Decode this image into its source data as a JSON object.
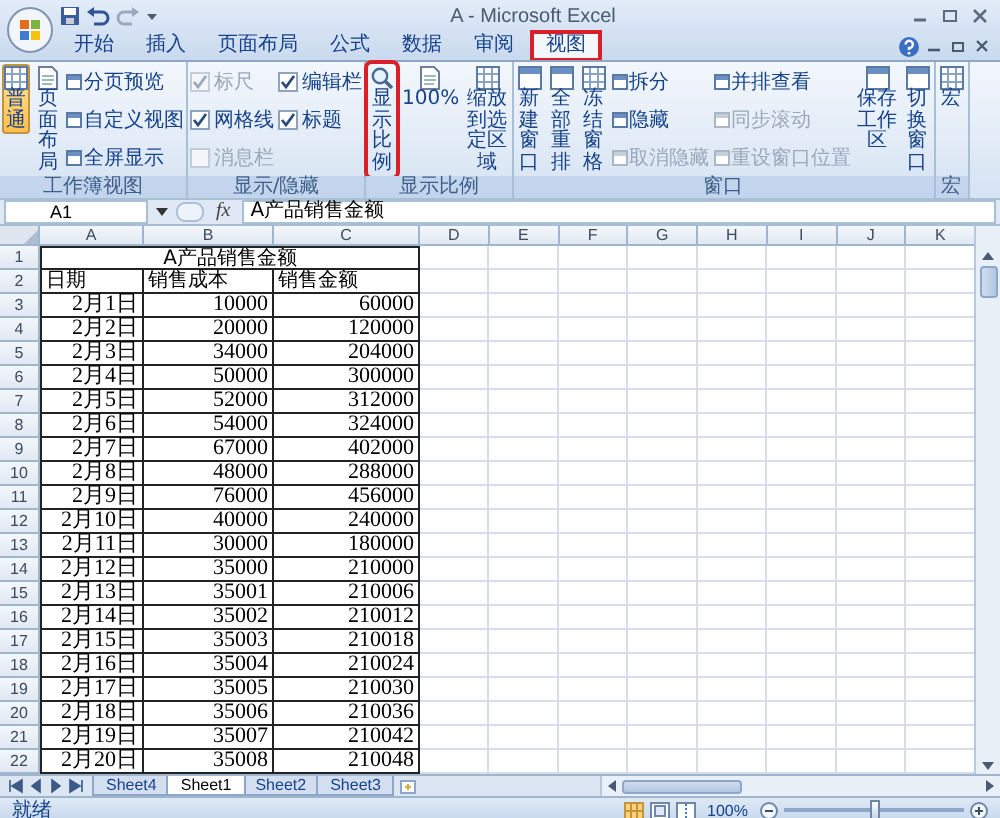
{
  "window": {
    "title": "A - Microsoft Excel"
  },
  "tabs": [
    {
      "label": "开始",
      "selected": false,
      "highlighted": false
    },
    {
      "label": "插入",
      "selected": false,
      "highlighted": false
    },
    {
      "label": "页面布局",
      "selected": false,
      "highlighted": false
    },
    {
      "label": "公式",
      "selected": false,
      "highlighted": false
    },
    {
      "label": "数据",
      "selected": false,
      "highlighted": false
    },
    {
      "label": "审阅",
      "selected": false,
      "highlighted": false
    },
    {
      "label": "视图",
      "selected": true,
      "highlighted": true
    }
  ],
  "ribbon": {
    "groups": [
      {
        "label": "工作簿视图",
        "items": [
          {
            "kind": "tall",
            "label": "普通",
            "selected": true,
            "highlighted": false
          },
          {
            "kind": "tall",
            "label": "页面布局",
            "selected": false,
            "highlighted": false
          },
          {
            "kind": "column",
            "items": [
              {
                "kind": "small",
                "label": "分页预览",
                "disabled": false
              },
              {
                "kind": "small",
                "label": "自定义视图",
                "disabled": false
              },
              {
                "kind": "small",
                "label": "全屏显示",
                "disabled": false
              }
            ]
          }
        ]
      },
      {
        "label": "显示/隐藏",
        "items": [
          {
            "kind": "column",
            "items": [
              {
                "kind": "check",
                "label": "标尺",
                "checked": true,
                "disabled": true
              },
              {
                "kind": "check",
                "label": "网格线",
                "checked": true,
                "disabled": false
              },
              {
                "kind": "check",
                "label": "消息栏",
                "checked": false,
                "disabled": true
              }
            ]
          },
          {
            "kind": "column",
            "items": [
              {
                "kind": "check",
                "label": "编辑栏",
                "checked": true,
                "disabled": false
              },
              {
                "kind": "check",
                "label": "标题",
                "checked": true,
                "disabled": false
              }
            ]
          }
        ]
      },
      {
        "label": "显示比例",
        "items": [
          {
            "kind": "tall",
            "label": "显示比例",
            "selected": false,
            "highlighted": true
          },
          {
            "kind": "plain",
            "label": "100%",
            "selected": false,
            "highlighted": false
          },
          {
            "kind": "wide",
            "label": "缩放到选定区域",
            "selected": false,
            "highlighted": false
          }
        ]
      },
      {
        "label": "窗口",
        "items": [
          {
            "kind": "tall",
            "label": "新建窗口",
            "selected": false,
            "highlighted": false
          },
          {
            "kind": "tall",
            "label": "全部重排",
            "selected": false,
            "highlighted": false
          },
          {
            "kind": "tall",
            "label": "冻结窗格",
            "selected": false,
            "highlighted": false
          },
          {
            "kind": "column",
            "items": [
              {
                "kind": "small",
                "label": "拆分",
                "disabled": false
              },
              {
                "kind": "small",
                "label": "隐藏",
                "disabled": false
              },
              {
                "kind": "small",
                "label": "取消隐藏",
                "disabled": true
              }
            ]
          },
          {
            "kind": "column",
            "items": [
              {
                "kind": "small",
                "label": "并排查看",
                "disabled": false
              },
              {
                "kind": "small",
                "label": "同步滚动",
                "disabled": true
              },
              {
                "kind": "small",
                "label": "重设窗口位置",
                "disabled": true
              }
            ]
          },
          {
            "kind": "wide",
            "label": "保存工作区",
            "selected": false,
            "highlighted": false
          },
          {
            "kind": "tall",
            "label": "切换窗口",
            "selected": false,
            "highlighted": false
          }
        ]
      },
      {
        "label": "宏",
        "items": [
          {
            "kind": "tall",
            "label": "宏",
            "selected": false,
            "highlighted": false
          }
        ]
      }
    ]
  },
  "formula_bar": {
    "name_box": "A1",
    "function_label": "fx",
    "content": "A产品销售金额"
  },
  "columns": [
    "A",
    "B",
    "C",
    "D",
    "E",
    "F",
    "G",
    "H",
    "I",
    "J",
    "K"
  ],
  "sheet": {
    "title_row": {
      "number": "1",
      "text": "A产品销售金额"
    },
    "header_row": {
      "number": "2",
      "cells": [
        "日期",
        "销售成本",
        "销售金额"
      ]
    },
    "data_rows": [
      {
        "number": "3",
        "cells": [
          "2月1日",
          "10000",
          "60000"
        ]
      },
      {
        "number": "4",
        "cells": [
          "2月2日",
          "20000",
          "120000"
        ]
      },
      {
        "number": "5",
        "cells": [
          "2月3日",
          "34000",
          "204000"
        ]
      },
      {
        "number": "6",
        "cells": [
          "2月4日",
          "50000",
          "300000"
        ]
      },
      {
        "number": "7",
        "cells": [
          "2月5日",
          "52000",
          "312000"
        ]
      },
      {
        "number": "8",
        "cells": [
          "2月6日",
          "54000",
          "324000"
        ]
      },
      {
        "number": "9",
        "cells": [
          "2月7日",
          "67000",
          "402000"
        ]
      },
      {
        "number": "10",
        "cells": [
          "2月8日",
          "48000",
          "288000"
        ]
      },
      {
        "number": "11",
        "cells": [
          "2月9日",
          "76000",
          "456000"
        ]
      },
      {
        "number": "12",
        "cells": [
          "2月10日",
          "40000",
          "240000"
        ]
      },
      {
        "number": "13",
        "cells": [
          "2月11日",
          "30000",
          "180000"
        ]
      },
      {
        "number": "14",
        "cells": [
          "2月12日",
          "35000",
          "210000"
        ]
      },
      {
        "number": "15",
        "cells": [
          "2月13日",
          "35001",
          "210006"
        ]
      },
      {
        "number": "16",
        "cells": [
          "2月14日",
          "35002",
          "210012"
        ]
      },
      {
        "number": "17",
        "cells": [
          "2月15日",
          "35003",
          "210018"
        ]
      },
      {
        "number": "18",
        "cells": [
          "2月16日",
          "35004",
          "210024"
        ]
      },
      {
        "number": "19",
        "cells": [
          "2月17日",
          "35005",
          "210030"
        ]
      },
      {
        "number": "20",
        "cells": [
          "2月18日",
          "35006",
          "210036"
        ]
      },
      {
        "number": "21",
        "cells": [
          "2月19日",
          "35007",
          "210042"
        ]
      },
      {
        "number": "22",
        "cells": [
          "2月20日",
          "35008",
          "210048"
        ]
      }
    ]
  },
  "sheet_tabs": [
    {
      "label": "Sheet4",
      "selected": false
    },
    {
      "label": "Sheet1",
      "selected": true
    },
    {
      "label": "Sheet2",
      "selected": false
    },
    {
      "label": "Sheet3",
      "selected": false
    }
  ],
  "status_bar": {
    "text": "就绪",
    "zoom": "100%",
    "zoom_slider": {
      "level": 0.5
    }
  }
}
